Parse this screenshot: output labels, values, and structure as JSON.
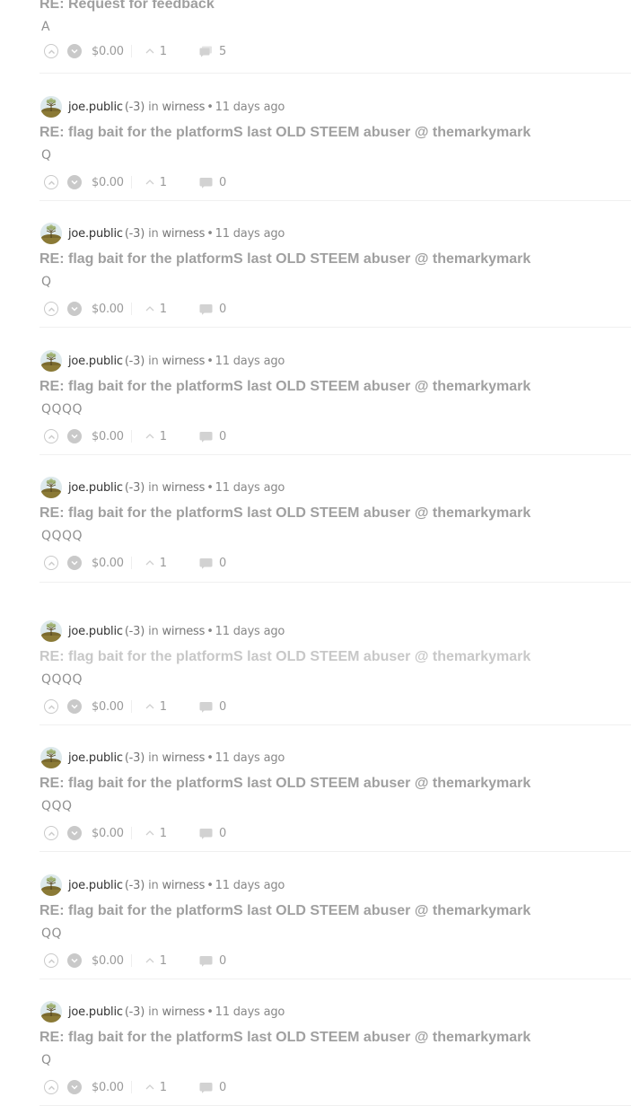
{
  "colors": {
    "title": "#a0a0a0",
    "title_faded": "#c8c8c8",
    "meta": "#888888",
    "author": "#333333",
    "icon": "#c9c9c9"
  },
  "posts": [
    {
      "title": "RE: Request for feedback",
      "body": "A",
      "payout": "$0.00",
      "votes": "1",
      "replies": "5",
      "has_author": false
    },
    {
      "author": "joe.public",
      "rep": "(-3)",
      "community_prefix": "in",
      "community": "wirness",
      "sep": "•",
      "time": "11 days ago",
      "title": "RE: flag bait for the platformS last OLD STEEM abuser @ themarkymark",
      "body": "Q",
      "payout": "$0.00",
      "votes": "1",
      "replies": "0"
    },
    {
      "author": "joe.public",
      "rep": "(-3)",
      "community_prefix": "in",
      "community": "wirness",
      "sep": "•",
      "time": "11 days ago",
      "title": "RE: flag bait for the platformS last OLD STEEM abuser @ themarkymark",
      "body": "Q",
      "payout": "$0.00",
      "votes": "1",
      "replies": "0"
    },
    {
      "author": "joe.public",
      "rep": "(-3)",
      "community_prefix": "in",
      "community": "wirness",
      "sep": "•",
      "time": "11 days ago",
      "title": "RE: flag bait for the platformS last OLD STEEM abuser @ themarkymark",
      "body": "QQQQ",
      "payout": "$0.00",
      "votes": "1",
      "replies": "0"
    },
    {
      "author": "joe.public",
      "rep": "(-3)",
      "community_prefix": "in",
      "community": "wirness",
      "sep": "•",
      "time": "11 days ago",
      "title": "RE: flag bait for the platformS last OLD STEEM abuser @ themarkymark",
      "body": "QQQQ",
      "payout": "$0.00",
      "votes": "1",
      "replies": "0"
    },
    {
      "author": "joe.public",
      "rep": "(-3)",
      "community_prefix": "in",
      "community": "wirness",
      "sep": "•",
      "time": "11 days ago",
      "title": "RE: flag bait for the platformS last OLD STEEM abuser @ themarkymark",
      "body": "QQQQ",
      "payout": "$0.00",
      "votes": "1",
      "replies": "0",
      "faded": true
    },
    {
      "author": "joe.public",
      "rep": "(-3)",
      "community_prefix": "in",
      "community": "wirness",
      "sep": "•",
      "time": "11 days ago",
      "title": "RE: flag bait for the platformS last OLD STEEM abuser @ themarkymark",
      "body": "QQQ",
      "payout": "$0.00",
      "votes": "1",
      "replies": "0"
    },
    {
      "author": "joe.public",
      "rep": "(-3)",
      "community_prefix": "in",
      "community": "wirness",
      "sep": "•",
      "time": "11 days ago",
      "title": "RE: flag bait for the platformS last OLD STEEM abuser @ themarkymark",
      "body": "QQ",
      "payout": "$0.00",
      "votes": "1",
      "replies": "0"
    },
    {
      "author": "joe.public",
      "rep": "(-3)",
      "community_prefix": "in",
      "community": "wirness",
      "sep": "•",
      "time": "11 days ago",
      "title": "RE: flag bait for the platformS last OLD STEEM abuser @ themarkymark",
      "body": "Q",
      "payout": "$0.00",
      "votes": "1",
      "replies": "0"
    }
  ]
}
